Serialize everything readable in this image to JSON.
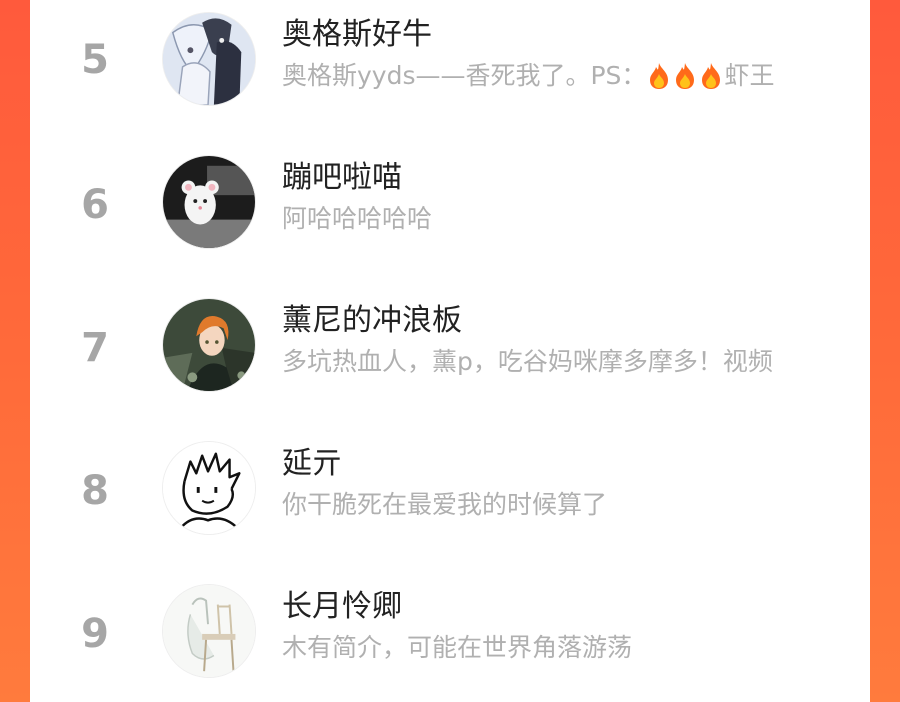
{
  "ranking": [
    {
      "rank": "5",
      "name": "奥格斯好牛",
      "bio_prefix": "奥格斯yyds——香死我了。PS：",
      "bio_suffix": "虾王",
      "avatar": "anime-boys-avatar"
    },
    {
      "rank": "6",
      "name": "蹦吧啦喵",
      "bio": "阿哈哈哈哈哈",
      "avatar": "white-mouse-avatar"
    },
    {
      "rank": "7",
      "name": "薰尼的冲浪板",
      "bio": "多坑热血人，薰p，吃谷妈咪摩多摩多！视频",
      "avatar": "orange-hair-boy-avatar"
    },
    {
      "rank": "8",
      "name": "延亓",
      "bio": "你干脆死在最爱我的时候算了",
      "avatar": "sketch-face-avatar"
    },
    {
      "rank": "9",
      "name": "长月怜卿",
      "bio": "木有简介，可能在世界角落游荡",
      "avatar": "chair-sketch-avatar"
    }
  ],
  "colors": {
    "background_gradient_top": "#ff5a3c",
    "background_gradient_bottom": "#ff7b3d",
    "panel": "#ffffff",
    "rank": "#a6a6a6",
    "name": "#222222",
    "bio": "#b0b0b0"
  },
  "icons": {
    "fire": "fire-emoji"
  }
}
